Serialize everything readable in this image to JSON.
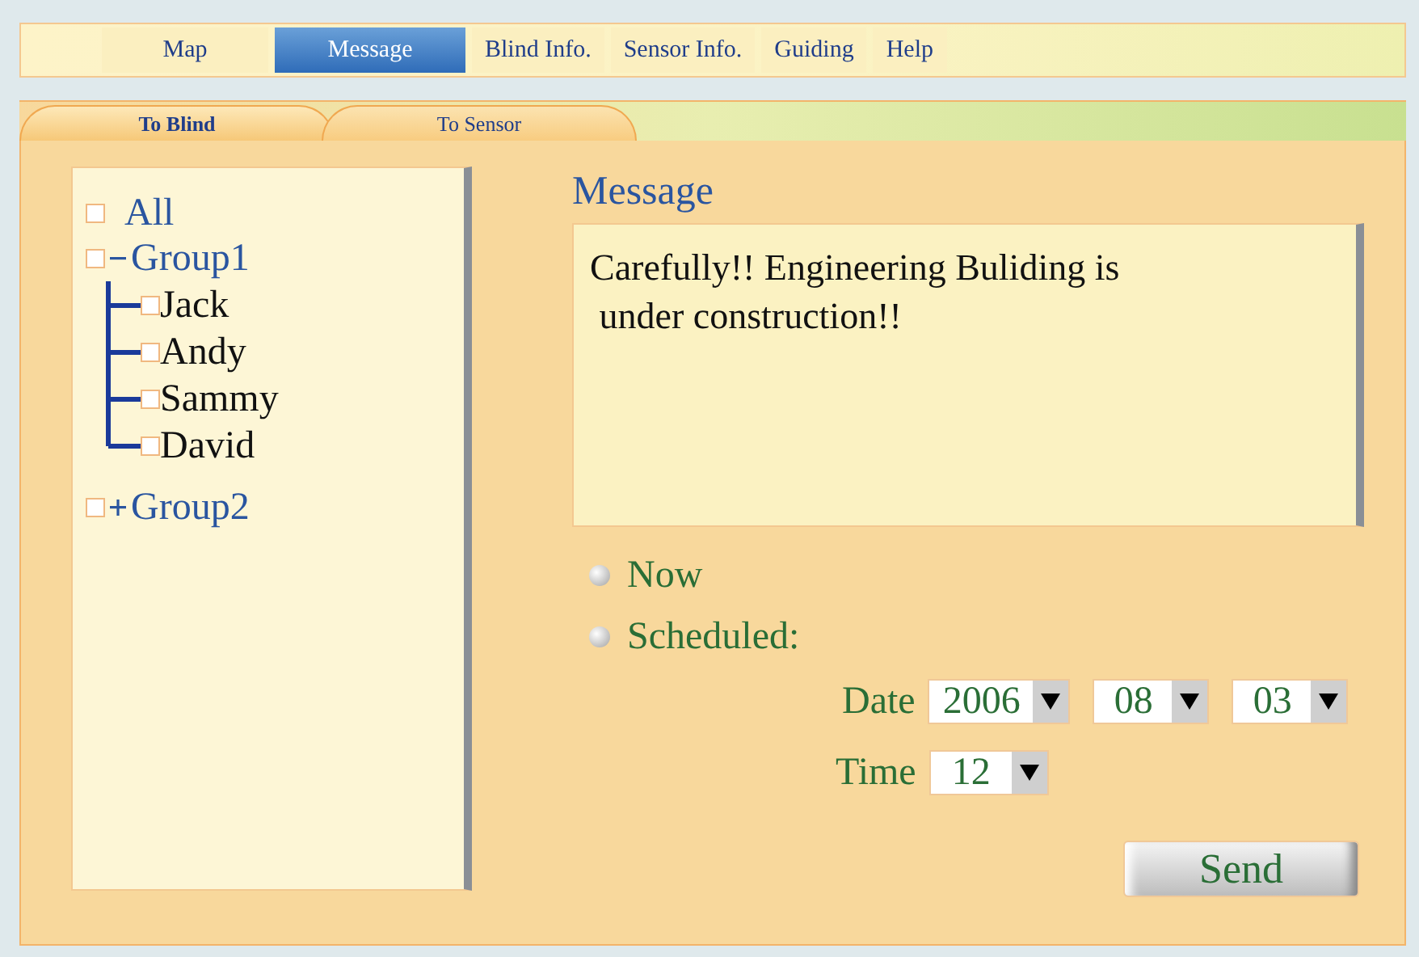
{
  "nav_tabs": [
    {
      "label": "Map",
      "selected": false
    },
    {
      "label": "Message",
      "selected": true
    },
    {
      "label": "Blind Info.",
      "selected": false
    },
    {
      "label": "Sensor Info.",
      "selected": false
    },
    {
      "label": "Guiding",
      "selected": false
    },
    {
      "label": "Help",
      "selected": false
    }
  ],
  "sub_tabs": [
    {
      "label": "To Blind",
      "selected": true
    },
    {
      "label": "To Sensor",
      "selected": false
    }
  ],
  "recipients": [
    {
      "label": "All",
      "checked": false
    },
    {
      "label": "Group1",
      "checked": false,
      "expanded": true,
      "children": [
        {
          "label": "Jack",
          "checked": false
        },
        {
          "label": "Andy",
          "checked": false
        },
        {
          "label": "Sammy",
          "checked": false
        },
        {
          "label": "David",
          "checked": false
        }
      ]
    },
    {
      "label": "Group2",
      "checked": false,
      "expanded": false
    }
  ],
  "message": {
    "label": "Message",
    "value": "Carefully!! Engineering Buliding is\n under construction!!"
  },
  "timing": [
    {
      "label": "Now",
      "selected": false
    },
    {
      "label": "Scheduled:",
      "selected": false
    }
  ],
  "date": {
    "label": "Date",
    "year": "2006",
    "month": "08",
    "day": "03"
  },
  "time": {
    "label": "Time",
    "hour": "12"
  },
  "send_button": "Send"
}
